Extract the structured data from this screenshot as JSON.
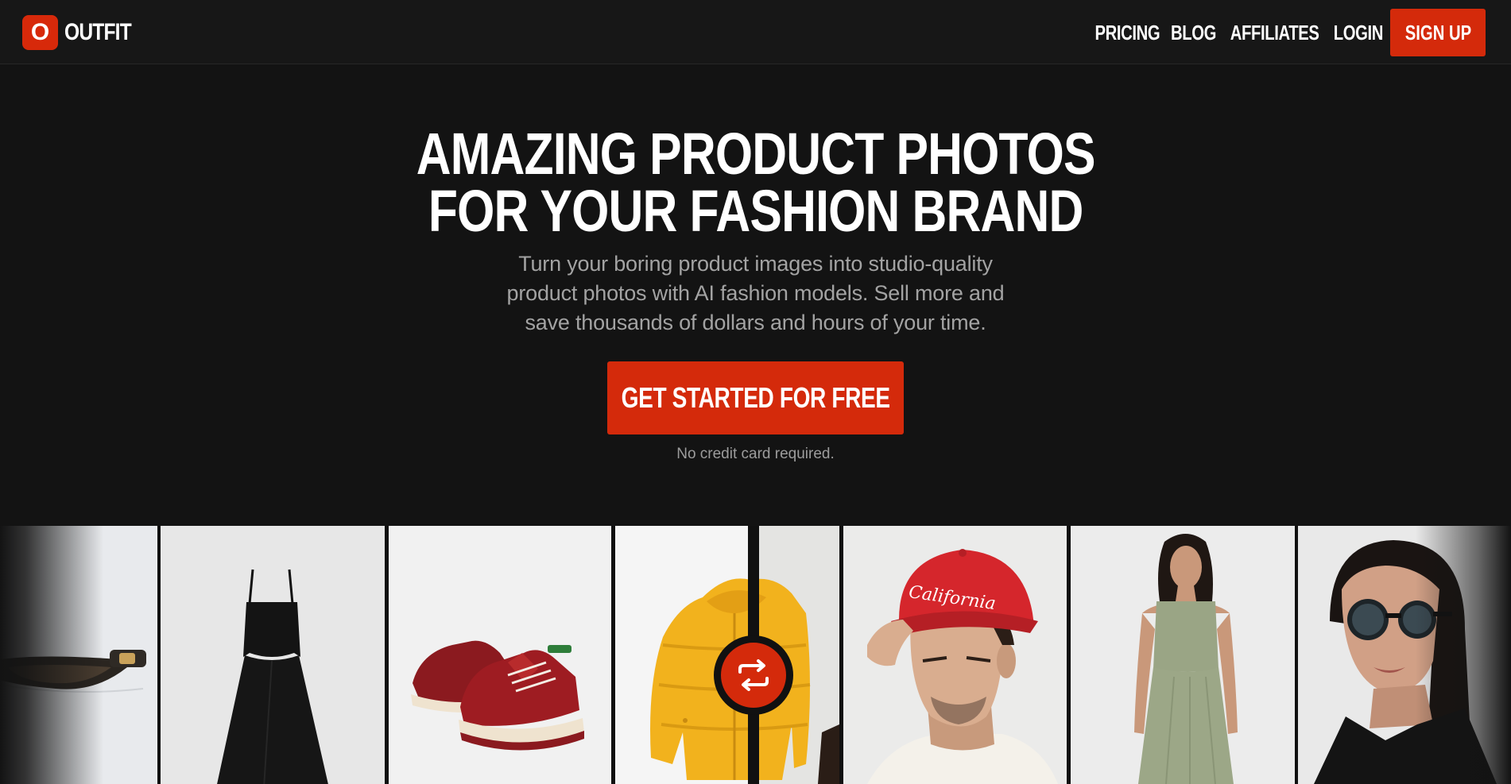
{
  "brand": {
    "logo_letter": "O",
    "name": "OUTFIT",
    "accent_color": "#d42a0b"
  },
  "nav": {
    "links": [
      {
        "label": "PRICING"
      },
      {
        "label": "BLOG"
      },
      {
        "label": "AFFILIATES"
      },
      {
        "label": "LOGIN"
      }
    ],
    "signup_label": "SIGN UP"
  },
  "hero": {
    "title_line1": "AMAZING PRODUCT PHOTOS",
    "title_line2": "FOR YOUR FASHION BRAND",
    "subtitle": "Turn your boring product images into studio-quality product photos with AI fashion models. Sell more and save thousands of dollars and hours of your time.",
    "cta_label": "GET STARTED FOR FREE",
    "cta_note": "No credit card required."
  },
  "gallery": {
    "tiles": [
      {
        "subject": "sunglasses"
      },
      {
        "subject": "black-dress"
      },
      {
        "subject": "red-sneakers"
      },
      {
        "subject": "yellow-puffer-jacket"
      },
      {
        "subject": "model-red-california-cap"
      },
      {
        "subject": "model-green-dress"
      },
      {
        "subject": "model-sunglasses"
      }
    ],
    "cap_text": "California",
    "swap_icon": "swap-arrows-icon"
  }
}
